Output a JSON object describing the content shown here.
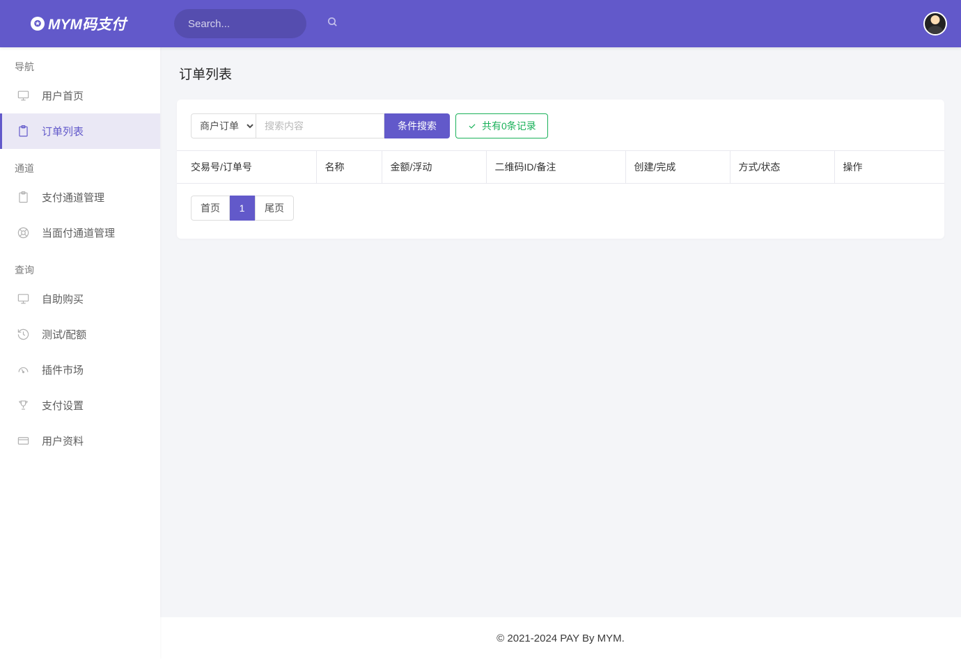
{
  "brand": {
    "logo_text": "MYM码支付"
  },
  "search": {
    "placeholder": "Search..."
  },
  "sidebar": {
    "sections": [
      {
        "title": "导航",
        "items": [
          {
            "label": "用户首页",
            "icon": "monitor",
            "active": false
          },
          {
            "label": "订单列表",
            "icon": "clipboard",
            "active": true
          }
        ]
      },
      {
        "title": "通道",
        "items": [
          {
            "label": "支付通道管理",
            "icon": "clipboard",
            "active": false
          },
          {
            "label": "当面付通道管理",
            "icon": "lifebuoy",
            "active": false
          }
        ]
      },
      {
        "title": "查询",
        "items": [
          {
            "label": "自助购买",
            "icon": "monitor",
            "active": false
          },
          {
            "label": "测试/配额",
            "icon": "history",
            "active": false
          },
          {
            "label": "插件市场",
            "icon": "gauge",
            "active": false
          },
          {
            "label": "支付设置",
            "icon": "trophy",
            "active": false
          },
          {
            "label": "用户资料",
            "icon": "card",
            "active": false
          }
        ]
      }
    ]
  },
  "page": {
    "title": "订单列表"
  },
  "toolbar": {
    "type_selected": "商户订单",
    "type_options": [
      "商户订单"
    ],
    "search_placeholder": "搜索内容",
    "search_btn": "条件搜索",
    "count_prefix": "共有 ",
    "count_value": "0",
    "count_suffix": " 条记录"
  },
  "table": {
    "headers": [
      "交易号/订单号",
      "名称",
      "金额/浮动",
      "二维码ID/备注",
      "创建/完成",
      "方式/状态",
      "操作"
    ],
    "rows": []
  },
  "pagination": {
    "first": "首页",
    "current": "1",
    "last": "尾页"
  },
  "footer": {
    "text": "© 2021-2024 PAY By MYM."
  }
}
